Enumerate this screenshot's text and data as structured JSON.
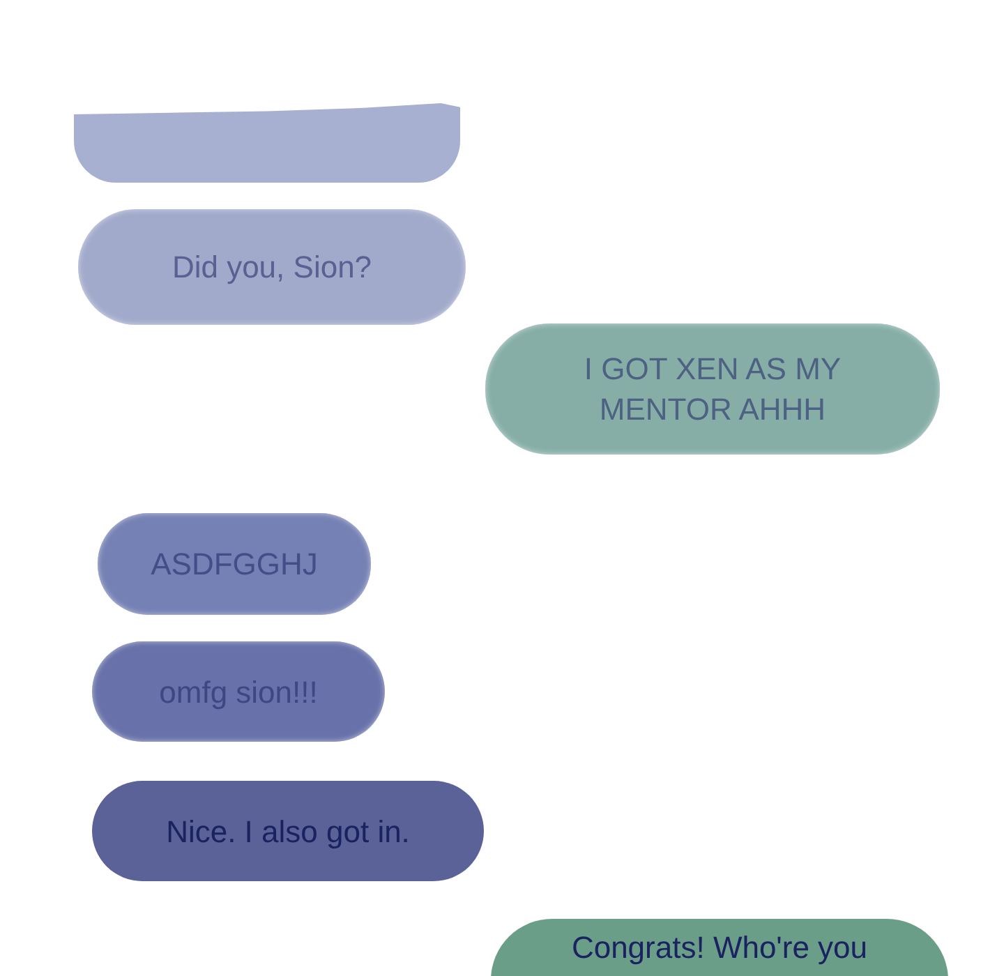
{
  "messages": [
    {
      "sent": false,
      "kind": "cropped",
      "color": "#a7b0d0"
    },
    {
      "sent": false,
      "kind": "faded",
      "color": "#a2aacb",
      "text": "Did you, Sion?"
    },
    {
      "sent": true,
      "kind": "faded",
      "color": "#86aea7",
      "text": "I GOT XEN AS MY MENTOR AHHH"
    },
    {
      "sent": false,
      "kind": "faded",
      "color": "#7580b4",
      "text": "ASDFGGHJ"
    },
    {
      "sent": false,
      "kind": "faded",
      "color": "#6871a9",
      "text": "omfg sion!!!"
    },
    {
      "sent": false,
      "kind": "sharp",
      "color": "#5b6298",
      "text": "Nice. I also got in."
    },
    {
      "sent": true,
      "kind": "sharp",
      "color": "#6a9e88",
      "text": "Congrats! Who're you"
    }
  ]
}
